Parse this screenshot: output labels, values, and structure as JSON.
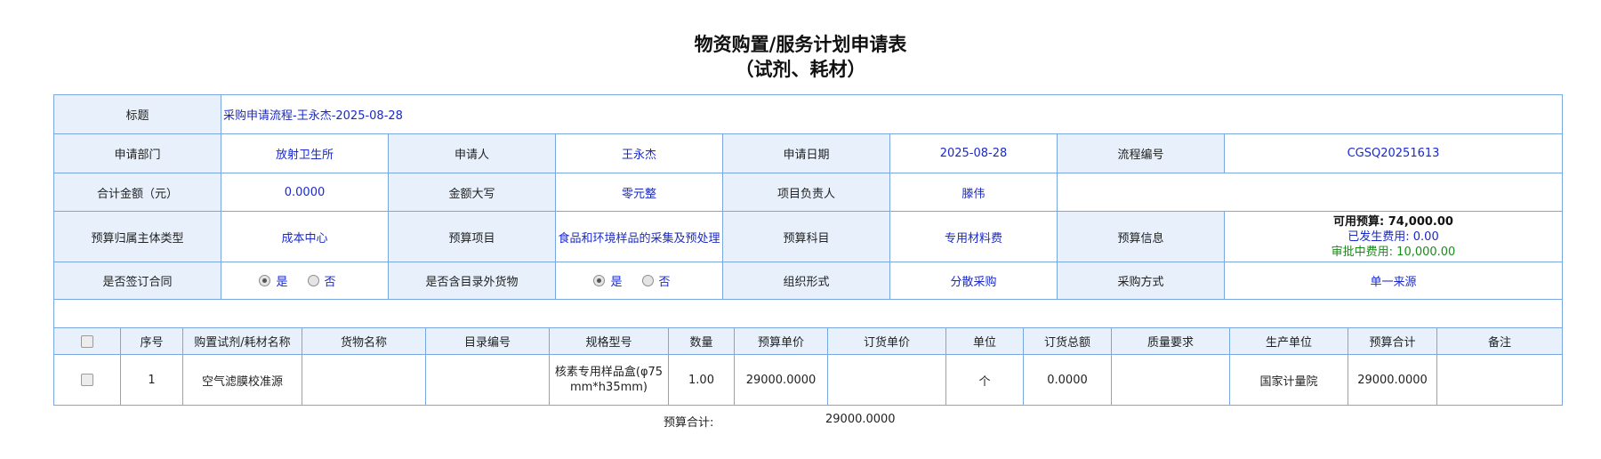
{
  "page": {
    "title_line1": "物资购置/服务计划申请表",
    "title_line2": "（试剂、耗材）"
  },
  "form": {
    "subject_label": "标题",
    "subject_value": "采购申请流程-王永杰-2025-08-28",
    "dept_label": "申请部门",
    "dept_value": "放射卫生所",
    "applicant_label": "申请人",
    "applicant_value": "王永杰",
    "date_label": "申请日期",
    "date_value": "2025-08-28",
    "flow_no_label": "流程编号",
    "flow_no_value": "CGSQ20251613",
    "total_amount_label": "合计金额（元）",
    "total_amount_value": "0.0000",
    "amount_upper_label": "金额大写",
    "amount_upper_value": "零元整",
    "project_lead_label": "项目负责人",
    "project_lead_value": "滕伟",
    "budget_subject_type_label": "预算归属主体类型",
    "budget_subject_type_value": "成本中心",
    "budget_project_label": "预算项目",
    "budget_project_value": "食品和环境样品的采集及预处理",
    "budget_account_label": "预算科目",
    "budget_account_value": "专用材料费",
    "budget_info_label": "预算信息",
    "budget_info": {
      "available": "可用预算: 74,000.00",
      "incurred": "已发生费用: 0.00",
      "in_approval": "审批中费用: 10,000.00"
    },
    "contract_label": "是否签订合同",
    "contract_options": {
      "yes": "是",
      "no": "否",
      "selected": "yes"
    },
    "out_of_catalog_label": "是否含目录外货物",
    "out_of_catalog_options": {
      "yes": "是",
      "no": "否",
      "selected": "yes"
    },
    "org_form_label": "组织形式",
    "org_form_value": "分散采购",
    "purchase_method_label": "采购方式",
    "purchase_method_value": "单一来源"
  },
  "items_table": {
    "columns": [
      "序号",
      "购置试剂/耗材名称",
      "货物名称",
      "目录编号",
      "规格型号",
      "数量",
      "预算单价",
      "订货单价",
      "单位",
      "订货总额",
      "质量要求",
      "生产单位",
      "预算合计",
      "备注"
    ],
    "rows": [
      {
        "seq": "1",
        "name": "空气滤膜校准源",
        "goods_name": "",
        "catalog_no": "",
        "spec": "核素专用样品盒(φ75mm*h35mm)",
        "qty": "1.00",
        "budget_price": "29000.0000",
        "order_price": "",
        "unit": "个",
        "order_total": "0.0000",
        "quality": "",
        "manufacturer": "国家计量院",
        "budget_total": "29000.0000",
        "remark": ""
      }
    ]
  },
  "footer": {
    "budget_total_label": "预算合计:",
    "budget_total_value": "29000.0000"
  }
}
